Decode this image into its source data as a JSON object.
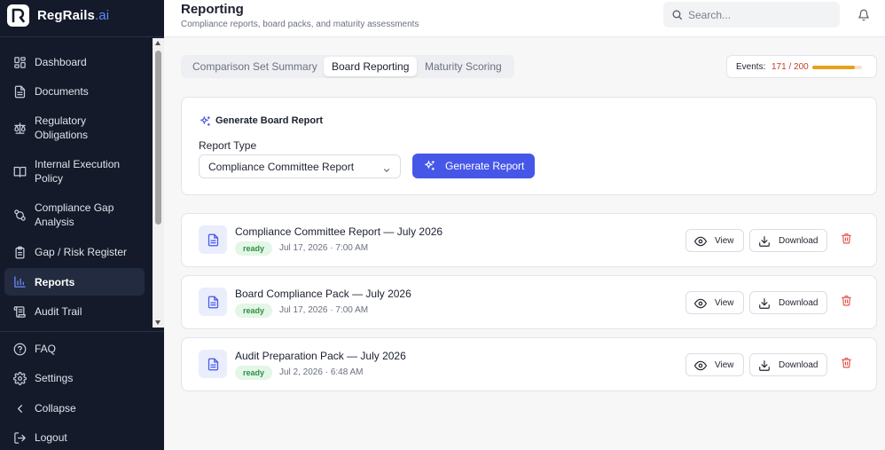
{
  "brand": {
    "name": "RegRails",
    "suffix": ".ai"
  },
  "sidebar": {
    "items": [
      {
        "label": "Dashboard",
        "icon": "dashboard-icon"
      },
      {
        "label": "Documents",
        "icon": "document-icon"
      },
      {
        "label": "Regulatory Obligations",
        "icon": "scale-icon"
      },
      {
        "label": "Internal Execution Policy",
        "icon": "book-icon"
      },
      {
        "label": "Compliance Gap Analysis",
        "icon": "git-compare-icon"
      },
      {
        "label": "Gap / Risk Register",
        "icon": "clipboard-icon"
      },
      {
        "label": "Reports",
        "icon": "bar-chart-icon",
        "active": true
      },
      {
        "label": "Audit Trail",
        "icon": "scroll-icon"
      }
    ],
    "footer": [
      {
        "label": "FAQ",
        "icon": "help-circle-icon"
      },
      {
        "label": "Settings",
        "icon": "gear-icon"
      },
      {
        "label": "Collapse",
        "icon": "chevron-left-icon"
      },
      {
        "label": "Logout",
        "icon": "logout-icon"
      }
    ]
  },
  "header": {
    "title": "Reporting",
    "subtitle": "Compliance reports, board packs, and maturity assessments",
    "search_placeholder": "Search..."
  },
  "tabs": [
    {
      "label": "Comparison Set Summary"
    },
    {
      "label": "Board Reporting",
      "active": true
    },
    {
      "label": "Maturity Scoring"
    }
  ],
  "events": {
    "label": "Events:",
    "count": "171 / 200",
    "used": 171,
    "limit": 200,
    "bar_color": "#e6a21b"
  },
  "generate": {
    "title": "Generate Board Report",
    "type_label": "Report Type",
    "selected_type": "Compliance Committee Report",
    "button_label": "Generate Report",
    "accent": "#4657e8"
  },
  "reports": [
    {
      "title": "Compliance Committee Report — July 2026",
      "status": "ready",
      "date": "Jul 17, 2026 · 7:00 AM"
    },
    {
      "title": "Board Compliance Pack — July 2026",
      "status": "ready",
      "date": "Jul 17, 2026 · 7:00 AM"
    },
    {
      "title": "Audit Preparation Pack — July 2026",
      "status": "ready",
      "date": "Jul 2, 2026 · 6:48 AM"
    }
  ],
  "report_actions": {
    "view_label": "View",
    "download_label": "Download"
  },
  "colors": {
    "sidebar_bg": "#141a29",
    "ready_badge": "#2f8f45",
    "delete": "#e0463a"
  }
}
